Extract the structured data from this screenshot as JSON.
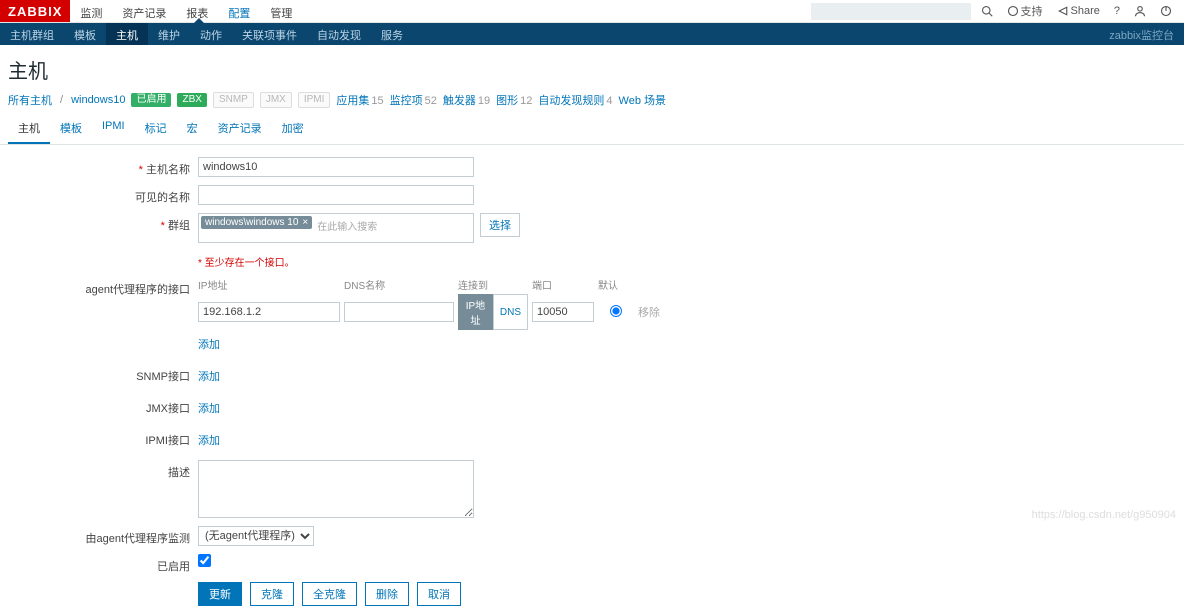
{
  "logo": "ZABBIX",
  "topnav": {
    "items": [
      "监测",
      "资产记录",
      "报表",
      "配置",
      "管理"
    ],
    "activeIndex": 3
  },
  "toptools": {
    "support": "支持",
    "share": "Share"
  },
  "subbar": {
    "items": [
      "主机群组",
      "模板",
      "主机",
      "维护",
      "动作",
      "关联项事件",
      "自动发现",
      "服务"
    ],
    "activeIndex": 2,
    "right": "zabbix监控台"
  },
  "page_title": "主机",
  "crumb": {
    "all": "所有主机",
    "host": "windows10",
    "status": "已启用",
    "avail": [
      "ZBX",
      "SNMP",
      "JMX",
      "IPMI"
    ],
    "counters": [
      {
        "label": "应用集",
        "n": "15"
      },
      {
        "label": "监控项",
        "n": "52"
      },
      {
        "label": "触发器",
        "n": "19"
      },
      {
        "label": "图形",
        "n": "12"
      },
      {
        "label": "自动发现规则",
        "n": "4"
      },
      {
        "label": "Web 场景",
        "n": ""
      }
    ]
  },
  "formtabs": {
    "items": [
      "主机",
      "模板",
      "IPMI",
      "标记",
      "宏",
      "资产记录",
      "加密"
    ],
    "activeIndex": 0
  },
  "form": {
    "hostname": {
      "label": "主机名称",
      "value": "windows10"
    },
    "visiblename": {
      "label": "可见的名称",
      "value": ""
    },
    "groups": {
      "label": "群组",
      "items": [
        "windows\\windows 10"
      ],
      "placeholder": "在此输入搜索",
      "select": "选择"
    },
    "iface_hint": "至少存在一个接口。",
    "agent": {
      "label": "agent代理程序的接口",
      "hdr": {
        "ip": "IP地址",
        "dns": "DNS名称",
        "connect": "连接到",
        "port": "端口",
        "default": "默认"
      },
      "ip": "192.168.1.2",
      "dns": "",
      "connect": {
        "ip": "IP地址",
        "dns": "DNS"
      },
      "port": "10050",
      "remove": "移除",
      "add": "添加"
    },
    "snmp": {
      "label": "SNMP接口",
      "add": "添加"
    },
    "jmx": {
      "label": "JMX接口",
      "add": "添加"
    },
    "ipmi": {
      "label": "IPMI接口",
      "add": "添加"
    },
    "description": {
      "label": "描述",
      "value": ""
    },
    "proxy": {
      "label": "由agent代理程序监测",
      "value": "(无agent代理程序)"
    },
    "enabled": {
      "label": "已启用",
      "checked": true
    },
    "buttons": {
      "update": "更新",
      "clone": "克隆",
      "fullclone": "全克隆",
      "delete": "删除",
      "cancel": "取消"
    }
  },
  "watermark": "https://blog.csdn.net/g950904"
}
